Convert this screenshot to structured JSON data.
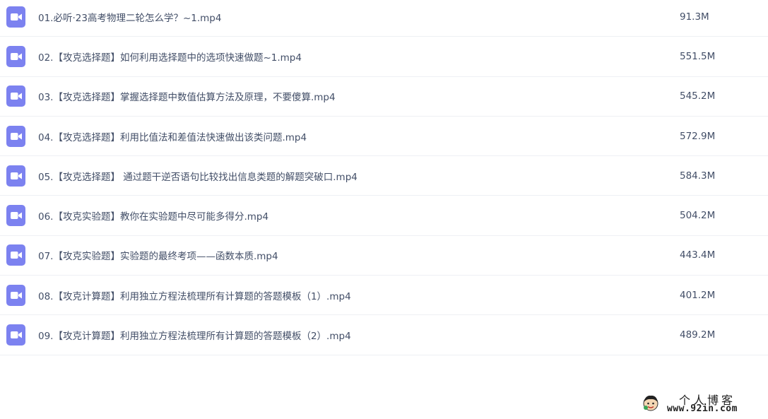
{
  "files": [
    {
      "name": "01.必听·23高考物理二轮怎么学？~1.mp4",
      "size": "91.3M",
      "icon": "video-file-icon"
    },
    {
      "name": "02.【攻克选择题】如何利用选择题中的选项快速做题~1.mp4",
      "size": "551.5M",
      "icon": "video-file-icon"
    },
    {
      "name": "03.【攻克选择题】掌握选择题中数值估算方法及原理，不要傻算.mp4",
      "size": "545.2M",
      "icon": "video-file-icon"
    },
    {
      "name": "04.【攻克选择题】利用比值法和差值法快速做出该类问题.mp4",
      "size": "572.9M",
      "icon": "video-file-icon"
    },
    {
      "name": "05.【攻克选择题】 通过题干逆否语句比较找出信息类题的解题突破口.mp4",
      "size": "584.3M",
      "icon": "video-file-icon"
    },
    {
      "name": "06.【攻克实验题】教你在实验题中尽可能多得分.mp4",
      "size": "504.2M",
      "icon": "video-file-icon"
    },
    {
      "name": "07.【攻克实验题】实验题的最终考项——函数本质.mp4",
      "size": "443.4M",
      "icon": "video-file-icon"
    },
    {
      "name": "08.【攻克计算题】利用独立方程法梳理所有计算题的答题模板（1）.mp4",
      "size": "401.2M",
      "icon": "video-file-icon"
    },
    {
      "name": "09.【攻克计算题】利用独立方程法梳理所有计算题的答题模板（2）.mp4",
      "size": "489.2M",
      "icon": "video-file-icon"
    }
  ],
  "colors": {
    "icon_bg": "#7c82f0",
    "text": "#424e67",
    "row_border": "#eef0f4"
  },
  "watermark": {
    "title": "个人博客",
    "url": "www.92in.com"
  }
}
